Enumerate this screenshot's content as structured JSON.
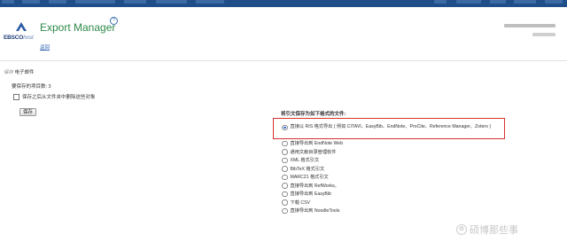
{
  "header": {
    "app_title": "Export Manager",
    "back_link": "返回",
    "logo_text_main": "EBSCO",
    "logo_text_sub": "host"
  },
  "save_section": {
    "label_prefix": "保存",
    "label_value": "电子邮件",
    "item_count_text": "要保存的项目数: 3",
    "remove_checkbox_label": "保存之后从文件夹中删除这些对象",
    "save_button": "保存"
  },
  "format_section": {
    "title": "将引文保存为如下格式的文件:",
    "selected_index": 0,
    "options": [
      "直接以 RIS 格式导出 ( 例如 CITAVI、EasyBib、EndNote、ProCite、Reference Manager、Zotero )",
      "直接导出到 EndNote Web",
      "通用文献目录管理软件",
      "XML 格式引文",
      "BibTeX 格式引文",
      "MARC21 格式引文",
      "直接导出到 RefWorks。",
      "直接导出到 EasyBib",
      "下载 CSV",
      "直接导出到 NoodleTools"
    ]
  },
  "watermark": {
    "text": "硕博那些事"
  },
  "colors": {
    "accent_red": "#d93030",
    "title_green": "#2f8a4a",
    "nav_blue": "#1f4e89"
  }
}
